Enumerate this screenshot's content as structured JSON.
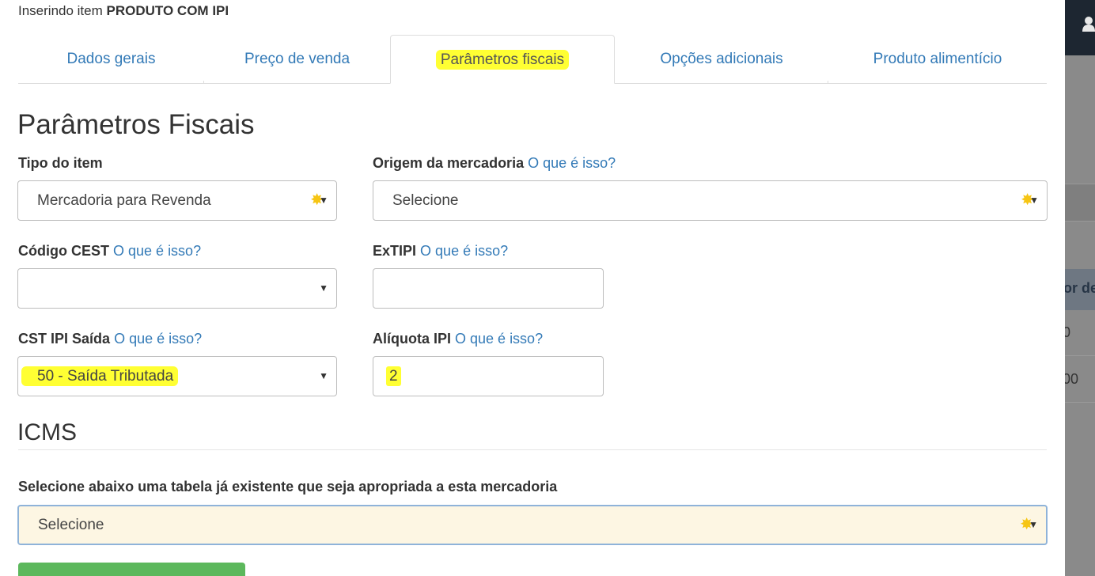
{
  "header": {
    "prefix": "Inserindo item",
    "product": "PRODUTO COM IPI"
  },
  "tabs": [
    {
      "label": "Dados gerais",
      "active": false
    },
    {
      "label": "Preço de venda",
      "active": false
    },
    {
      "label": "Parâmetros fiscais",
      "active": true
    },
    {
      "label": "Opções adicionais",
      "active": false
    },
    {
      "label": "Produto alimentício",
      "active": false
    }
  ],
  "section_fiscal": {
    "title": "Parâmetros Fiscais"
  },
  "help_link": "O que é isso?",
  "fields": {
    "tipo_item": {
      "label": "Tipo do item",
      "value": "Mercadoria para Revenda"
    },
    "origem": {
      "label": "Origem da mercadoria",
      "value": "Selecione"
    },
    "cest": {
      "label": "Código CEST",
      "value": ""
    },
    "extipi": {
      "label": "ExTIPI",
      "value": ""
    },
    "cst_ipi": {
      "label": "CST IPI Saída",
      "value": "50 - Saída Tributada"
    },
    "aliquota_ipi": {
      "label": "Alíquota IPI",
      "value": "2"
    }
  },
  "section_icms": {
    "title": "ICMS",
    "table_label": "Selecione abaixo uma tabela já existente que seja apropriada a esta mercadoria",
    "table_value": "Selecione"
  },
  "background": {
    "header_text": "or de",
    "row1": "0",
    "row2": "00"
  },
  "colors": {
    "link": "#337ab7",
    "highlight": "#ffff33",
    "required_star": "#f6c514",
    "success": "#5cb85c"
  },
  "icons": {
    "required": "required-star-icon",
    "dropdown": "caret-down-icon",
    "user": "user-icon"
  }
}
